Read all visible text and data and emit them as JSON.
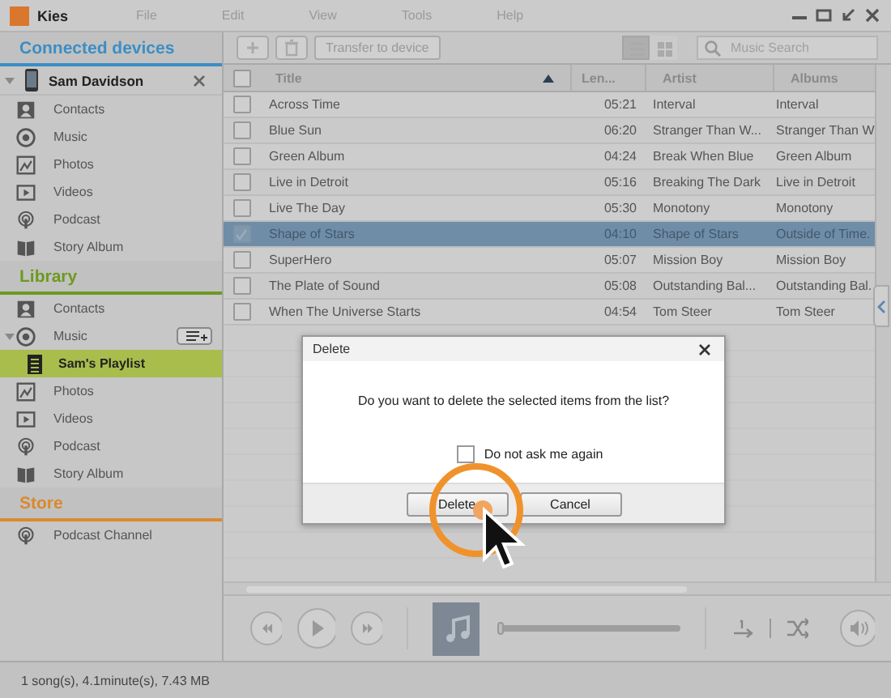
{
  "window": {
    "title": "Kies"
  },
  "menu": [
    "File",
    "Edit",
    "View",
    "Tools",
    "Help"
  ],
  "sidebar": {
    "sections": [
      {
        "kind": "devices",
        "title": "Connected devices",
        "device": {
          "name": "Sam Davidson",
          "expanded": true
        },
        "items": [
          {
            "label": "Contacts",
            "kind": "contacts",
            "selected": false
          },
          {
            "label": "Music",
            "kind": "music",
            "selected": false
          },
          {
            "label": "Photos",
            "kind": "photos",
            "selected": false
          },
          {
            "label": "Videos",
            "kind": "videos",
            "selected": false
          },
          {
            "label": "Podcast",
            "kind": "podcast",
            "selected": false
          },
          {
            "label": "Story Album",
            "kind": "story",
            "selected": false
          }
        ]
      },
      {
        "kind": "library",
        "title": "Library",
        "items": [
          {
            "label": "Contacts",
            "kind": "contacts",
            "selected": false
          },
          {
            "label": "Music",
            "kind": "music",
            "selected": false,
            "expanded": true,
            "add_button": true,
            "children": [
              {
                "label": "Sam's Playlist",
                "kind": "playlist",
                "selected": true
              }
            ]
          },
          {
            "label": "Photos",
            "kind": "photos",
            "selected": false
          },
          {
            "label": "Videos",
            "kind": "videos",
            "selected": false
          },
          {
            "label": "Podcast",
            "kind": "podcast",
            "selected": false
          },
          {
            "label": "Story Album",
            "kind": "story",
            "selected": false
          }
        ]
      },
      {
        "kind": "store",
        "title": "Store",
        "items": [
          {
            "label": "Podcast Channel",
            "kind": "podcast",
            "selected": false
          }
        ]
      }
    ]
  },
  "toolbar": {
    "transfer_button": "Transfer to device",
    "search": {
      "placeholder": "Music Search"
    },
    "view_buttons": [
      {
        "kind": "list",
        "selected": true
      },
      {
        "kind": "grid",
        "selected": false
      }
    ]
  },
  "table": {
    "all_checked": false,
    "columns": [
      {
        "label": "Title",
        "sorted": true
      },
      {
        "label": "Len...",
        "sorted": false
      },
      {
        "label": "Artist",
        "sorted": false
      },
      {
        "label": "Albums",
        "sorted": false
      }
    ],
    "rows": [
      {
        "title": "Across Time",
        "length": "05:21",
        "artist": "Interval",
        "album": "Interval",
        "checked": false,
        "selected": false
      },
      {
        "title": "Blue Sun",
        "length": "06:20",
        "artist": "Stranger Than W...",
        "album": "Stranger Than W",
        "checked": false,
        "selected": false
      },
      {
        "title": "Green Album",
        "length": "04:24",
        "artist": "Break When Blue",
        "album": "Green Album",
        "checked": false,
        "selected": false
      },
      {
        "title": "Live in Detroit",
        "length": "05:16",
        "artist": "Breaking The Dark",
        "album": "Live in Detroit",
        "checked": false,
        "selected": false
      },
      {
        "title": "Live The Day",
        "length": "05:30",
        "artist": "Monotony",
        "album": "Monotony",
        "checked": false,
        "selected": false
      },
      {
        "title": "Shape of Stars",
        "length": "04:10",
        "artist": "Shape of Stars",
        "album": "Outside of Time.",
        "checked": true,
        "selected": true
      },
      {
        "title": "SuperHero",
        "length": "05:07",
        "artist": "Mission Boy",
        "album": "Mission Boy",
        "checked": false,
        "selected": false
      },
      {
        "title": "The Plate of Sound",
        "length": "05:08",
        "artist": "Outstanding Bal...",
        "album": "Outstanding Bal.",
        "checked": false,
        "selected": false
      },
      {
        "title": "When The Universe Starts",
        "length": "04:54",
        "artist": "Tom Steer",
        "album": "Tom Steer",
        "checked": false,
        "selected": false
      }
    ]
  },
  "player": {
    "level": 0
  },
  "status_bar": "1 song(s), 4.1minute(s), 7.43 MB",
  "dialog": {
    "title": "Delete",
    "message": "Do you want to delete the selected items from the list?",
    "checkbox": {
      "label": "Do not ask me again",
      "checked": false
    },
    "buttons": [
      "Delete",
      "Cancel"
    ]
  }
}
